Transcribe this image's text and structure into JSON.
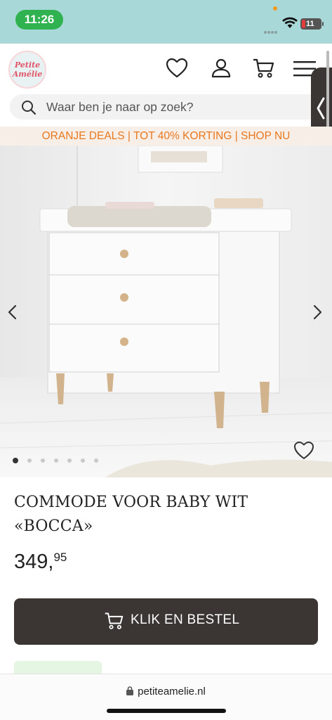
{
  "status_bar": {
    "time": "11:26",
    "battery": "11"
  },
  "header": {
    "logo_line1": "Petite",
    "logo_line2": "Amélie",
    "icons": [
      "heart-icon",
      "user-icon",
      "cart-icon",
      "menu-icon"
    ]
  },
  "search": {
    "placeholder": "Waar ben je naar op zoek?"
  },
  "promo": {
    "text": "ORANJE DEALS | TOT 40% KORTING | SHOP NU"
  },
  "gallery": {
    "total_dots": 7,
    "active_dot": 1
  },
  "product": {
    "title_line1": "COMMODE VOOR BABY WIT",
    "title_line2": "«BOCCA»",
    "price_main": "349,",
    "price_cents": "95"
  },
  "cta": {
    "label": "KLIK EN BESTEL"
  },
  "browser": {
    "url": "petiteamelie.nl"
  },
  "colors": {
    "brand_dark": "#3b3533",
    "promo_orange": "#e8781e",
    "status_bg": "#a9d8d8",
    "time_green": "#2fb24f"
  }
}
